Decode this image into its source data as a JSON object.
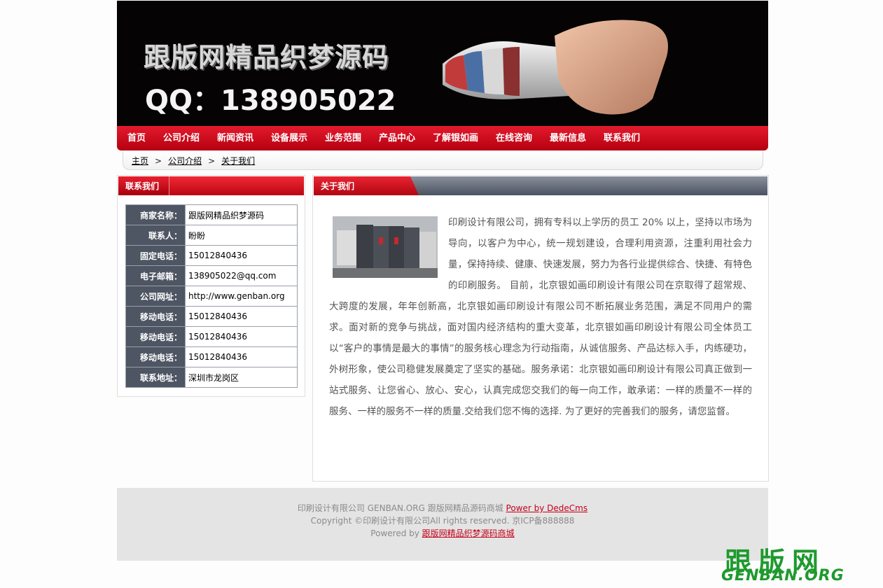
{
  "banner": {
    "title": "跟版网精品织梦源码",
    "qq": "QQ：138905022"
  },
  "nav": {
    "items": [
      "首页",
      "公司介绍",
      "新闻资讯",
      "设备展示",
      "业务范围",
      "产品中心",
      "了解银如画",
      "在线咨询",
      "最新信息",
      "联系我们"
    ]
  },
  "breadcrumb": {
    "home": "主页",
    "sep": ">",
    "level1": "公司介绍",
    "level2": "关于我们"
  },
  "contact": {
    "title": "联系我们",
    "rows": [
      {
        "label": "商家名称：",
        "value": "跟版网精品织梦源码"
      },
      {
        "label": "联系人：",
        "value": "盼盼"
      },
      {
        "label": "固定电话：",
        "value": "15012840436"
      },
      {
        "label": "电子邮箱：",
        "value": "138905022@qq.com"
      },
      {
        "label": "公司网址：",
        "value": "http://www.genban.org"
      },
      {
        "label": "移动电话：",
        "value": "15012840436"
      },
      {
        "label": "移动电话：",
        "value": "15012840436"
      },
      {
        "label": "移动电话：",
        "value": "15012840436"
      },
      {
        "label": "联系地址：",
        "value": "深圳市龙岗区"
      }
    ]
  },
  "about": {
    "title": "关于我们",
    "text": "印刷设计有限公司，拥有专科以上学历的员工 20% 以上，坚持以市场为导向，以客户为中心，统一规划建设，合理利用资源，注重利用社会力量，保持持续、健康、快速发展，努力为各行业提供综合、快捷、有特色的印刷服务。 目前，北京银如画印刷设计有限公司在京取得了超常规、大跨度的发展，年年创新高，北京银如画印刷设计有限公司不断拓展业务范围，满足不同用户的需求。面对新的竞争与挑战，面对国内经济结构的重大变革，北京银如画印刷设计有限公司全体员工以“客户的事情是最大的事情”的服务核心理念为行动指南，从诚信服务、产品达标入手，内练硬功，外树形象，使公司稳健发展奠定了坚实的基础。服务承诺：北京银如画印刷设计有限公司真正做到一站式服务、让您省心、放心、安心，认真完成您交我们的每一向工作，敢承诺：一样的质量不一样的服务、一样的服务不一样的质量.交给我们您不悔的选择. 为了更好的完善我们的服务，请您监督。"
  },
  "footer": {
    "line1_text": "印刷设计有限公司 GENBAN.ORG 跟版网精品源码商城 ",
    "line1_link": "Power by DedeCms",
    "line2": "Copyright ©印刷设计有限公司All rights reserved. 京ICP备888888",
    "line3_text": "Powered by ",
    "line3_link": "跟版网精品织梦源码商城"
  },
  "watermark": {
    "cn": "跟版网",
    "en": "GENBAN.ORG"
  }
}
